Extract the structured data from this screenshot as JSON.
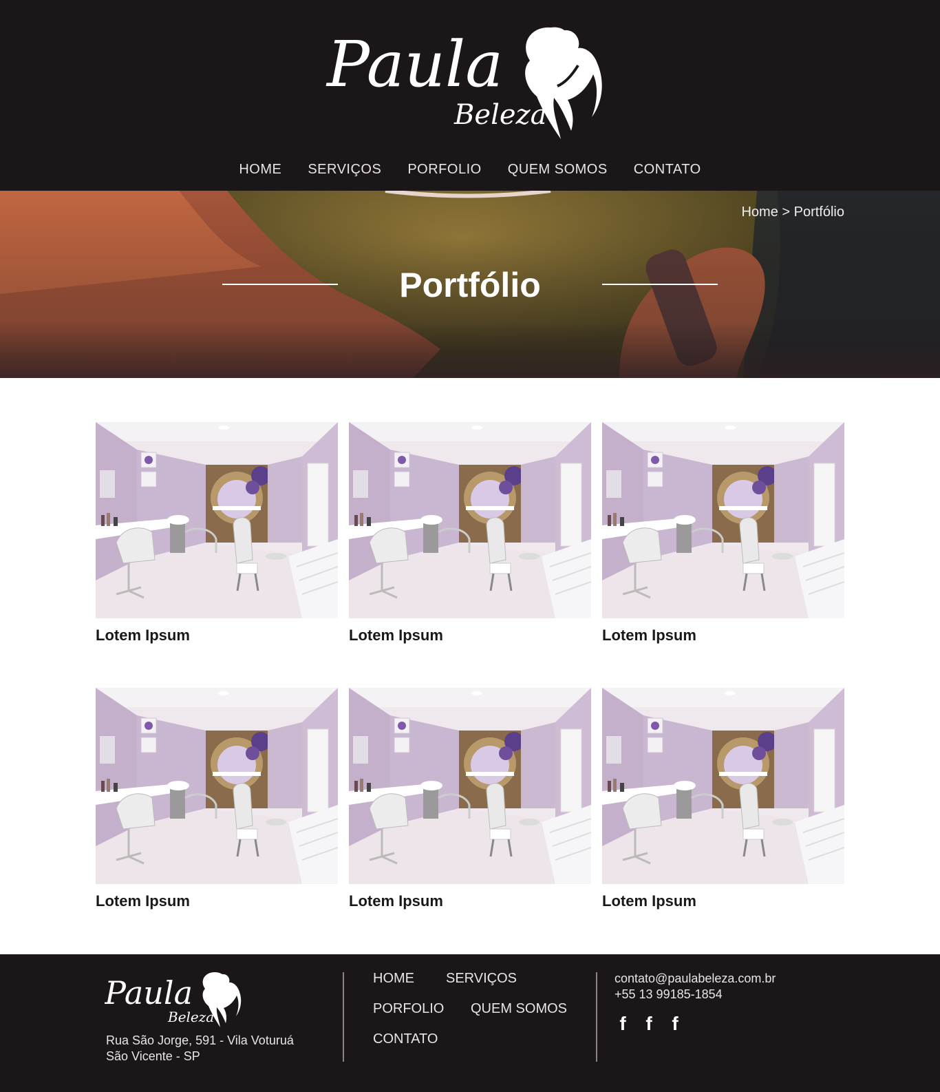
{
  "brand": {
    "name_main": "Paula",
    "name_sub": "Beleza"
  },
  "nav": {
    "items": [
      {
        "label": "HOME"
      },
      {
        "label": "SERVIÇOS"
      },
      {
        "label": "PORFOLIO"
      },
      {
        "label": "QUEM SOMOS"
      },
      {
        "label": "CONTATO"
      }
    ]
  },
  "hero": {
    "breadcrumb": "Home > Portfólio",
    "title": "Portfólio"
  },
  "gallery": {
    "items": [
      {
        "caption": "Lotem Ipsum"
      },
      {
        "caption": "Lotem Ipsum"
      },
      {
        "caption": "Lotem Ipsum"
      },
      {
        "caption": "Lotem Ipsum"
      },
      {
        "caption": "Lotem Ipsum"
      },
      {
        "caption": "Lotem Ipsum"
      }
    ]
  },
  "footer": {
    "address_line1": "Rua São Jorge, 591 -  Vila Voturuá",
    "address_line2": "São Vicente - SP",
    "nav": [
      {
        "label": "HOME"
      },
      {
        "label": "SERVIÇOS"
      },
      {
        "label": "PORFOLIO"
      },
      {
        "label": "QUEM SOMOS"
      },
      {
        "label": "CONTATO"
      }
    ],
    "email": "contato@paulabeleza.com.br",
    "phone": "+55 13 99185-1854",
    "social": [
      {
        "icon": "facebook-icon",
        "glyph": "f"
      },
      {
        "icon": "facebook-icon",
        "glyph": "f"
      },
      {
        "icon": "facebook-icon",
        "glyph": "f"
      }
    ]
  },
  "colors": {
    "header_bg": "#1b1718",
    "text_light": "#e9e4e6",
    "accent_lilac": "#c9b3d6"
  }
}
